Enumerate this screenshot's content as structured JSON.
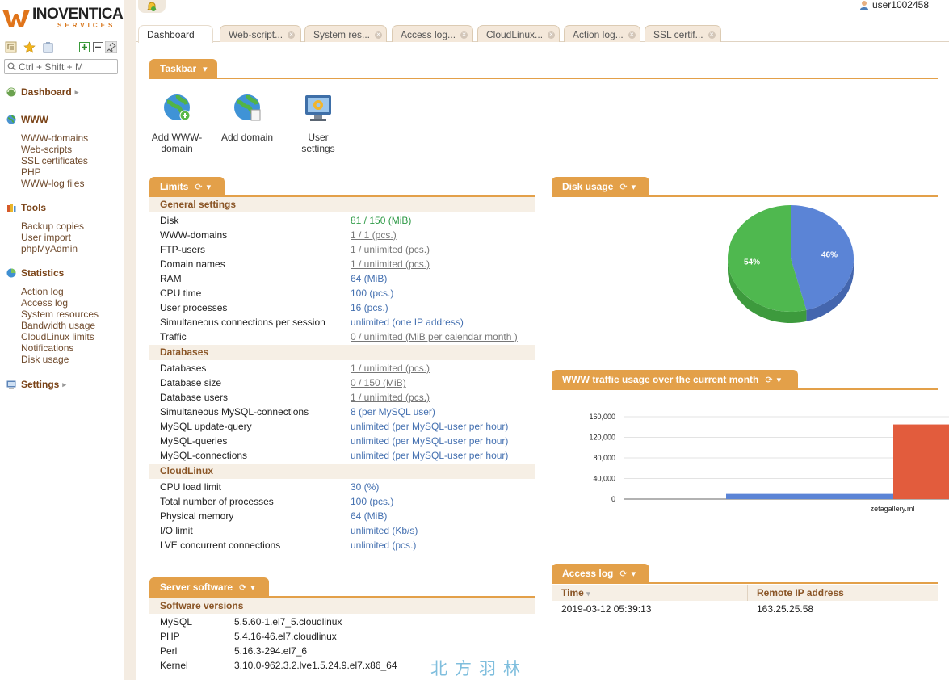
{
  "brand": {
    "name": "INOVENTICA",
    "sub": "SERVICES"
  },
  "search": {
    "placeholder": "Ctrl + Shift + M"
  },
  "user": {
    "name": "user1002458"
  },
  "sidebar": {
    "dashboard": "Dashboard",
    "www": {
      "title": "WWW",
      "items": [
        "WWW-domains",
        "Web-scripts",
        "SSL certificates",
        "PHP",
        "WWW-log files"
      ]
    },
    "tools": {
      "title": "Tools",
      "items": [
        "Backup copies",
        "User import",
        "phpMyAdmin"
      ]
    },
    "statistics": {
      "title": "Statistics",
      "items": [
        "Action log",
        "Access log",
        "System resources",
        "Bandwidth usage",
        "CloudLinux limits",
        "Notifications",
        "Disk usage"
      ]
    },
    "settings": "Settings"
  },
  "tabs": [
    "Dashboard",
    "Web-script...",
    "System res...",
    "Access log...",
    "CloudLinux...",
    "Action log...",
    "SSL certif..."
  ],
  "taskbar": {
    "title": "Taskbar",
    "items": [
      {
        "label1": "Add WWW-",
        "label2": "domain"
      },
      {
        "label1": "Add domain",
        "label2": ""
      },
      {
        "label1": "User",
        "label2": "settings"
      }
    ]
  },
  "limits": {
    "title": "Limits",
    "general": {
      "title": "General settings",
      "rows": [
        [
          "Disk",
          "81 / 150 (MiB)"
        ],
        [
          "WWW-domains",
          "1 / 1 (pcs.)"
        ],
        [
          "FTP-users",
          "1 / unlimited (pcs.)"
        ],
        [
          "Domain names",
          "1 / unlimited (pcs.)"
        ],
        [
          "RAM",
          "64 (MiB)"
        ],
        [
          "CPU time",
          "100 (pcs.)"
        ],
        [
          "User processes",
          "16 (pcs.)"
        ],
        [
          "Simultaneous connections per session",
          "unlimited (one IP address)"
        ],
        [
          "Traffic",
          "0 / unlimited (MiB per calendar month )"
        ]
      ]
    },
    "databases": {
      "title": "Databases",
      "rows": [
        [
          "Databases",
          "1 / unlimited (pcs.)"
        ],
        [
          "Database size",
          "0 / 150 (MiB)"
        ],
        [
          "Database users",
          "1 / unlimited (pcs.)"
        ],
        [
          "Simultaneous MySQL-connections",
          "8 (per MySQL user)"
        ],
        [
          "MySQL update-query",
          "unlimited (per MySQL-user per hour)"
        ],
        [
          "MySQL-queries",
          "unlimited (per MySQL-user per hour)"
        ],
        [
          "MySQL-connections",
          "unlimited (per MySQL-user per hour)"
        ]
      ]
    },
    "cloudlinux": {
      "title": "CloudLinux",
      "rows": [
        [
          "CPU load limit",
          "30 (%)"
        ],
        [
          "Total number of processes",
          "100 (pcs.)"
        ],
        [
          "Physical memory",
          "64 (MiB)"
        ],
        [
          "I/O limit",
          "unlimited (Kb/s)"
        ],
        [
          "LVE concurrent connections",
          "unlimited (pcs.)"
        ]
      ]
    }
  },
  "server_software": {
    "title": "Server software",
    "section": "Software versions",
    "rows": [
      [
        "MySQL",
        "5.5.60-1.el7_5.cloudlinux"
      ],
      [
        "PHP",
        "5.4.16-46.el7.cloudlinux"
      ],
      [
        "Perl",
        "5.16.3-294.el7_6"
      ],
      [
        "Kernel",
        "3.10.0-962.3.2.lve1.5.24.9.el7.x86_64"
      ]
    ]
  },
  "disk_usage": {
    "title": "Disk usage"
  },
  "traffic": {
    "title": "WWW traffic usage over the current month"
  },
  "access_log": {
    "title": "Access log",
    "col_time": "Time",
    "col_ip": "Remote IP address",
    "rows": [
      [
        "2019-03-12 05:39:13",
        "163.25.25.58"
      ]
    ]
  },
  "watermark": "北方羽林",
  "colors": {
    "accent": "#e3a049",
    "pie_blue": "#5b84d6",
    "pie_green": "#4fb84f",
    "bar_red": "#e25c3d"
  },
  "chart_data": [
    {
      "type": "pie",
      "title": "Disk usage",
      "values": [
        46,
        54
      ],
      "labels": [
        "46%",
        "54%"
      ],
      "colors": [
        "#5b84d6",
        "#4fb84f"
      ]
    },
    {
      "type": "bar",
      "title": "WWW traffic usage over the current month",
      "categories": [
        "",
        "zetagallery.ml"
      ],
      "series": [
        {
          "values": [
            10000,
            0
          ],
          "color": "#5b84d6"
        },
        {
          "values": [
            0,
            145000
          ],
          "color": "#e25c3d"
        }
      ],
      "yticks": [
        "160,000",
        "120,000",
        "80,000",
        "40,000",
        "0"
      ],
      "ylim": [
        0,
        160000
      ],
      "grid": true
    }
  ]
}
